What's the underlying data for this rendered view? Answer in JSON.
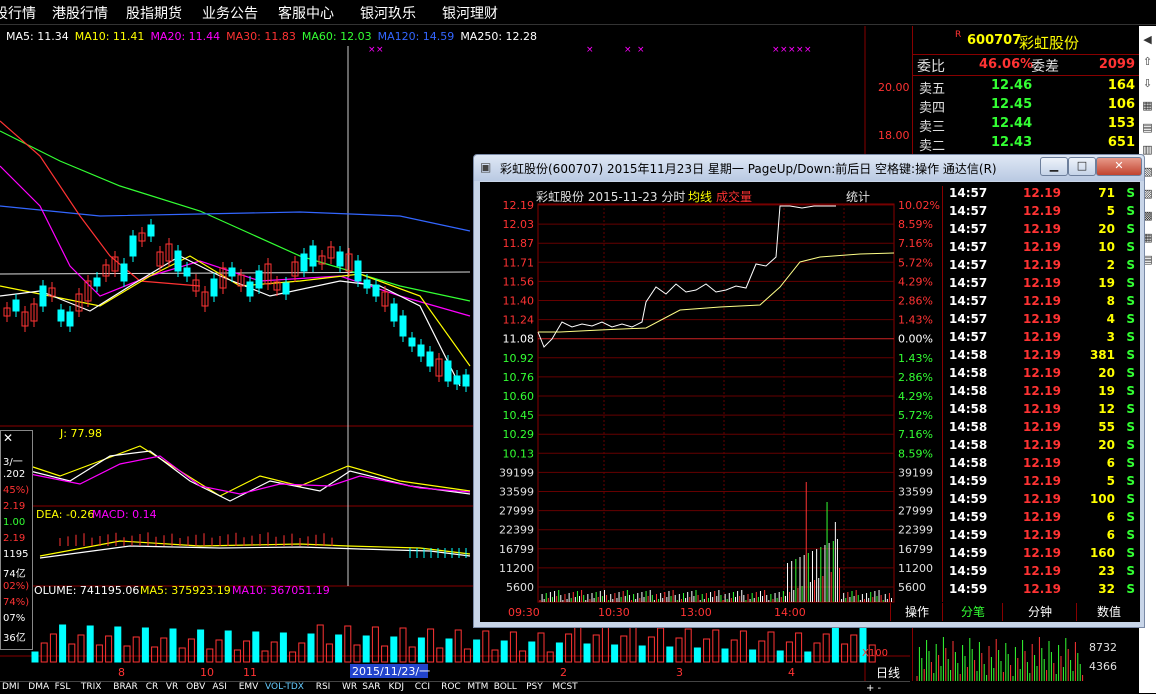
{
  "menu": [
    "股行情",
    "港股行情",
    "股指期货",
    "业务公告",
    "客服中心",
    "银河玖乐",
    "银河理财"
  ],
  "ma_legend": [
    {
      "text": "MA5: 11.34",
      "color": "#ffffff"
    },
    {
      "text": "MA10: 11.41",
      "color": "#ffff00"
    },
    {
      "text": "MA20: 11.44",
      "color": "#ff00ff"
    },
    {
      "text": "MA30: 11.83",
      "color": "#ff3333"
    },
    {
      "text": "MA60: 12.03",
      "color": "#33ff33"
    },
    {
      "text": "MA120: 14.59",
      "color": "#3366ff"
    },
    {
      "text": "MA250: 12.28",
      "color": "#ffffff"
    }
  ],
  "price_scale": [
    "20.00",
    "18.00"
  ],
  "kdj_label": "J: 77.98",
  "macd_label": {
    "dea": "DEA: -0.26",
    "macd": "MACD: 0.14"
  },
  "volume_label": {
    "vol": "OLUME: 741195.06",
    "ma5": "MA5: 375923.19",
    "ma10": "MA10: 367051.19"
  },
  "x_labels": [
    "8",
    "10",
    "11",
    "2",
    "3",
    "4"
  ],
  "date_highlight": "2015/11/23/一",
  "x100": "X100",
  "daily": "日线",
  "leftbox": [
    "3/一",
    ".202",
    "45%)",
    "2.19",
    "1.00",
    "2.19",
    "1195",
    "74亿",
    "02%)",
    "74%)",
    "07%",
    "36亿"
  ],
  "right": {
    "r_badge": "R",
    "code": "600707",
    "name": "彩虹股份",
    "weibi_label": "委比",
    "weibi_value": "46.06%",
    "weicha_label": "委差",
    "weicha_value": "2099",
    "asks": [
      {
        "label": "卖五",
        "price": "12.46",
        "vol": "164"
      },
      {
        "label": "卖四",
        "price": "12.45",
        "vol": "106"
      },
      {
        "label": "卖三",
        "price": "12.44",
        "vol": "153"
      },
      {
        "label": "卖二",
        "price": "12.43",
        "vol": "651"
      }
    ],
    "mini_vol": [
      "8732",
      "4366"
    ]
  },
  "popup": {
    "title": "彩虹股份(600707) 2015年11月23日 星期一 PageUp/Down:前后日 空格键:操作 通达信(R)",
    "header": "彩虹股份  2015-11-23 分时",
    "junxian": "均线",
    "chengjiao": "成交量",
    "tongji": "统计",
    "left_axis": [
      "12.19",
      "12.03",
      "11.87",
      "11.71",
      "11.56",
      "11.40",
      "11.24",
      "11.08",
      "10.92",
      "10.76",
      "10.60",
      "10.45",
      "10.29",
      "10.13",
      "39199",
      "33599",
      "27999",
      "22399",
      "16799",
      "11200",
      "5600"
    ],
    "right_axis": [
      "10.02%",
      "8.59%",
      "7.16%",
      "5.72%",
      "4.29%",
      "2.86%",
      "1.43%",
      "0.00%",
      "1.43%",
      "2.86%",
      "4.29%",
      "5.72%",
      "7.16%",
      "8.59%",
      "39199",
      "33599",
      "27999",
      "22399",
      "16799",
      "11200",
      "5600"
    ],
    "time_axis": [
      "09:30",
      "10:30",
      "13:00",
      "14:00"
    ],
    "tabs": [
      "操作",
      "分笔",
      "分钟",
      "数值"
    ],
    "ticks": [
      {
        "t": "14:57",
        "p": "12.19",
        "v": "71",
        "s": "S"
      },
      {
        "t": "14:57",
        "p": "12.19",
        "v": "5",
        "s": "S"
      },
      {
        "t": "14:57",
        "p": "12.19",
        "v": "20",
        "s": "S"
      },
      {
        "t": "14:57",
        "p": "12.19",
        "v": "10",
        "s": "S"
      },
      {
        "t": "14:57",
        "p": "12.19",
        "v": "2",
        "s": "S"
      },
      {
        "t": "14:57",
        "p": "12.19",
        "v": "19",
        "s": "S"
      },
      {
        "t": "14:57",
        "p": "12.19",
        "v": "8",
        "s": "S"
      },
      {
        "t": "14:57",
        "p": "12.19",
        "v": "4",
        "s": "S"
      },
      {
        "t": "14:57",
        "p": "12.19",
        "v": "3",
        "s": "S"
      },
      {
        "t": "14:58",
        "p": "12.19",
        "v": "381",
        "s": "S"
      },
      {
        "t": "14:58",
        "p": "12.19",
        "v": "20",
        "s": "S"
      },
      {
        "t": "14:58",
        "p": "12.19",
        "v": "19",
        "s": "S"
      },
      {
        "t": "14:58",
        "p": "12.19",
        "v": "12",
        "s": "S"
      },
      {
        "t": "14:58",
        "p": "12.19",
        "v": "55",
        "s": "S"
      },
      {
        "t": "14:58",
        "p": "12.19",
        "v": "20",
        "s": "S"
      },
      {
        "t": "14:58",
        "p": "12.19",
        "v": "6",
        "s": "S"
      },
      {
        "t": "14:59",
        "p": "12.19",
        "v": "5",
        "s": "S"
      },
      {
        "t": "14:59",
        "p": "12.19",
        "v": "100",
        "s": "S"
      },
      {
        "t": "14:59",
        "p": "12.19",
        "v": "6",
        "s": "S"
      },
      {
        "t": "14:59",
        "p": "12.19",
        "v": "6",
        "s": "S"
      },
      {
        "t": "14:59",
        "p": "12.19",
        "v": "160",
        "s": "S"
      },
      {
        "t": "14:59",
        "p": "12.19",
        "v": "23",
        "s": "S"
      },
      {
        "t": "14:59",
        "p": "12.19",
        "v": "32",
        "s": "S"
      }
    ]
  },
  "bottom_tabs": [
    "DMI",
    "DMA",
    "FSL",
    "TRIX",
    "BRAR",
    "CR",
    "VR",
    "OBV",
    "ASI",
    "EMV",
    "VOL-TDX",
    "RSI",
    "WR",
    "SAR",
    "KDJ",
    "CCI",
    "ROC",
    "MTM",
    "BOLL",
    "PSY",
    "MCST"
  ],
  "colors": {
    "up": "#ff3333",
    "down": "#00ffff",
    "frame": "#880000"
  }
}
